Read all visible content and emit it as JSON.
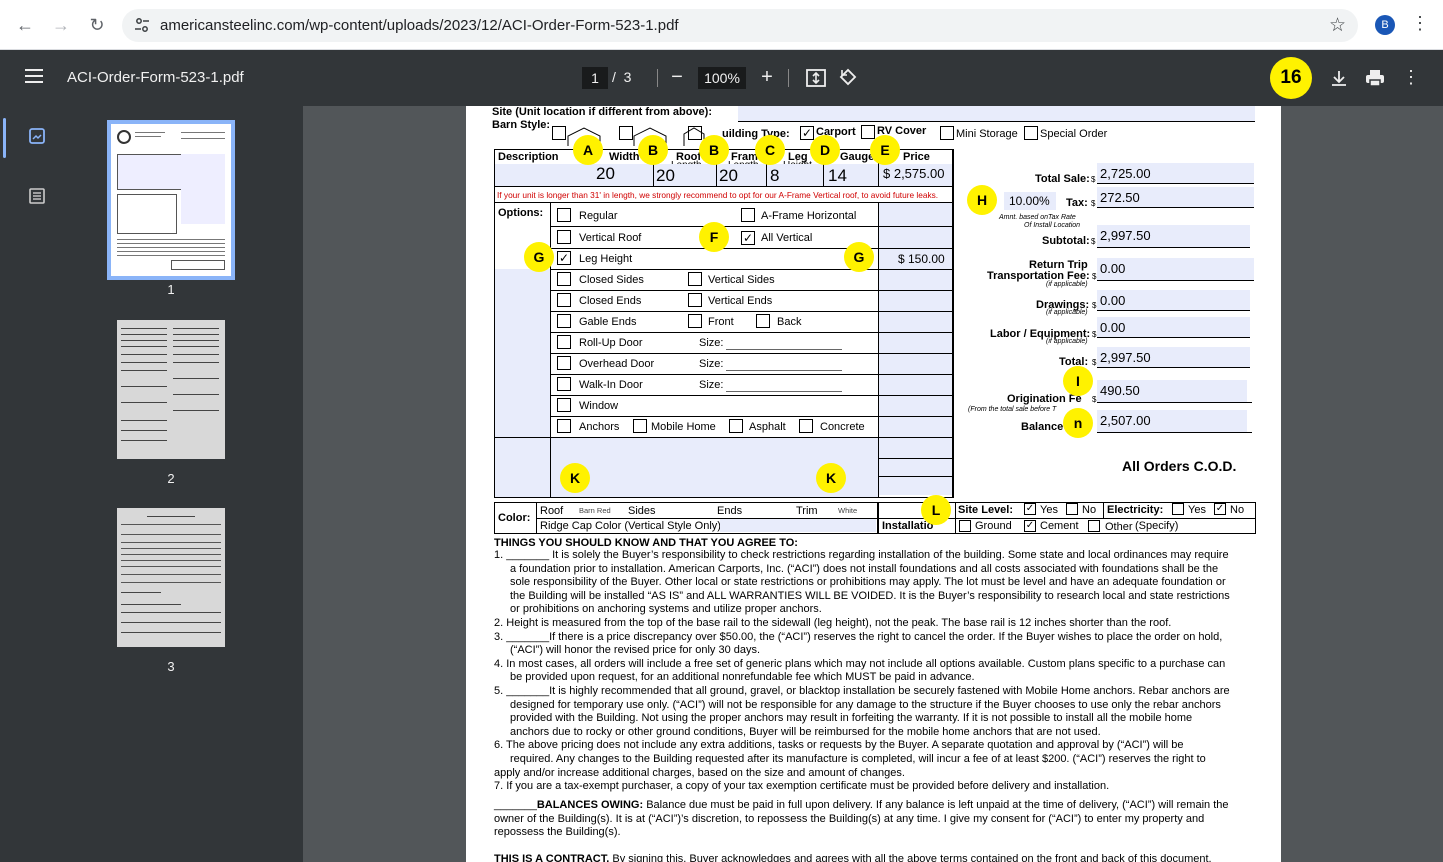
{
  "browser": {
    "url": "americansteelinc.com/wp-content/uploads/2023/12/ACI-Order-Form-523-1.pdf",
    "profile_initial": "B"
  },
  "viewer": {
    "filename": "ACI-Order-Form-523-1.pdf",
    "current_page": "1",
    "page_sep": "/",
    "total_pages": "3",
    "zoom": "100%",
    "badge": "16",
    "thumbnails": [
      "1",
      "2",
      "3"
    ]
  },
  "form": {
    "site_label": "Site (Unit location if different from above):",
    "barn_style": "Barn Style:",
    "building_type": "uilding Type:",
    "carport": "Carport",
    "rv_cover": "RV Cover",
    "mini_storage": "Mini Storage",
    "special_order": "Special Order",
    "headers": {
      "description": "Description",
      "width": "Width",
      "roof": "Roof",
      "roof_sub": "Length",
      "frame": "Frame",
      "frame_sub": "Length",
      "leg": "Leg",
      "leg_sub": "Height",
      "gauge": "Gauge",
      "price": "Price"
    },
    "values": {
      "width": "20",
      "roof": "20",
      "frame": "20",
      "leg": "8",
      "gauge": "14",
      "price": "$ 2,575.00"
    },
    "warning": "If your unit is longer than 31' in length, we strongly recommend to opt for our A-Frame Vertical roof, to avoid future leaks.",
    "options_label": "Options:",
    "options": {
      "regular": "Regular",
      "a_frame_horizontal": "A-Frame Horizontal",
      "vertical_roof": "Vertical Roof",
      "all_vertical": "All Vertical",
      "leg_height": "Leg Height",
      "leg_height_price": "$ 150.00",
      "closed_sides": "Closed Sides",
      "vertical_sides": "Vertical Sides",
      "closed_ends": "Closed Ends",
      "vertical_ends": "Vertical Ends",
      "gable_ends": "Gable Ends",
      "front": "Front",
      "back": "Back",
      "rollup_door": "Roll-Up Door",
      "overhead_door": "Overhead Door",
      "walkin_door": "Walk-In Door",
      "size": "Size:",
      "window": "Window",
      "anchors": "Anchors",
      "mobile_home": "Mobile Home",
      "asphalt": "Asphalt",
      "concrete": "Concrete"
    },
    "color": {
      "label": "Color:",
      "roof": "Roof",
      "roof_value": "Barn Red",
      "sides": "Sides",
      "ends": "Ends",
      "trim": "Trim",
      "trim_value": "White",
      "ridge_cap": "Ridge Cap Color (Vertical Style Only):",
      "installation": "Installatio"
    },
    "site_level": {
      "label": "Site Level:",
      "yes": "Yes",
      "no": "No",
      "electricity": "Electricity:",
      "ground": "Ground",
      "cement": "Cement",
      "other": "Other",
      "specify": "(Specify)"
    },
    "totals": {
      "total_sale_label": "Total Sale:",
      "total_sale": "2,725.00",
      "tax_rate": "10.00%",
      "tax_label": "Tax:",
      "tax": "272.50",
      "tax_note1": "Amnt. based onTax Rate",
      "tax_note2": "Of Install Location",
      "subtotal_label": "Subtotal:",
      "subtotal": "2,997.50",
      "return_trip_label": "Return Trip",
      "transport_label": "Transportation Fee:",
      "transport_note": "(if applicable)",
      "transport": "0.00",
      "drawings_label": "Drawings:",
      "drawings_note": "(if applicable)",
      "drawings": "0.00",
      "labor_label": "Labor / Equipment:",
      "labor_note": "(if applicable)",
      "labor": "0.00",
      "total_label": "Total:",
      "total": "2,997.50",
      "origination_label": "Origination Fe",
      "origination_note": "(From the total sale before T",
      "origination": "490.50",
      "balance_label": "Balance D",
      "balance": "2,507.00",
      "dollar": "$",
      "cod": "All Orders C.O.D."
    },
    "markers": {
      "a": "A",
      "b": "B",
      "c": "C",
      "d": "D",
      "e": "E",
      "f": "F",
      "g": "G",
      "h": "H",
      "i": "I",
      "n": "n",
      "k": "K",
      "l": "L"
    },
    "terms": {
      "heading": "THINGS YOU SHOULD KNOW AND THAT YOU AGREE TO:",
      "t1n": "1.",
      "t1a": "_______ It is solely the Buyer’s responsibility to check restrictions regarding installation of the building. Some state and local ordinances may require",
      "t1b": "a foundation prior to installation. American Carports, Inc. (“ACI”) does not install foundations and all costs associated with foundations shall be the",
      "t1c": "sole responsibility of the Buyer. Other local or state restrictions or prohibitions may apply. The lot must be level and have an adequate foundation or",
      "t1d": "the Building will be installed “AS IS” and ALL WARRANTIES WILL BE VOIDED. It is the Buyer’s responsibility to research local and state restrictions",
      "t1e": "or prohibitions on anchoring systems and utilize proper anchors.",
      "t2n": "2.",
      "t2a": "Height is measured from the top of the base rail to the sidewall (leg height), not the peak. The base rail is 12 inches shorter than the roof.",
      "t3n": "3.",
      "t3a": "_______If there is a price discrepancy over $50.00, the (“ACI”) reserves the right to cancel the order. If the Buyer wishes to place the order on hold,",
      "t3b": "(“ACI”) will honor the revised price for only 30 days.",
      "t4n": "4.",
      "t4a": "In most cases, all orders will include a free set of generic plans which may not include all options available. Custom plans specific to a purchase can",
      "t4b": "be provided upon request, for an additional nonrefundable fee which MUST be paid in advance.",
      "t5n": "5.",
      "t5a": "_______It is highly recommended that all ground, gravel, or blacktop installation be securely fastened with Mobile Home anchors. Rebar anchors are",
      "t5b": "designed for temporary use only. (“ACI”) will not be responsible for any damage to the structure if the Buyer chooses to use only the rebar anchors",
      "t5c": "provided with the Building. Not using the proper anchors may result in forfeiting the warranty. If it is not possible to install all the mobile home",
      "t5d": "anchors due to rocky or other ground conditions, Buyer will be reimbursed for the mobile home anchors that are not used.",
      "t6n": "6.",
      "t6a": "The above pricing does not include any extra additions, tasks or requests by the Buyer. A separate quotation and approval by (“ACI”) will be",
      "t6b": "required. Any changes to the Building requested after its manufacture is completed, will incur a fee of at least $200. (“ACI”) reserves the right to",
      "t6c": "apply and/or increase additional charges, based on the size and amount of changes.",
      "t7n": "7.",
      "t7a": "If you are a tax-exempt purchaser, a copy of your tax exemption certificate must be provided before delivery and installation.",
      "bal_blank": "_______",
      "bal_bold": "BALANCES OWING:",
      "bal_a": " Balance due must be paid in full upon delivery. If any balance is left unpaid at the time of delivery, (“ACI”) will remain the",
      "bal_b": "owner of the Building(s). It is at (“ACI”)’s discretion, to repossess the Building(s) at any time. I give my consent for (“ACI”) to enter my property and",
      "bal_c": "repossess the Building(s).",
      "contract_bold": "THIS IS A CONTRACT.",
      "contract_rest": " By signing this, Buyer acknowledges and agrees with all the above terms contained on the front and back of this document."
    }
  },
  "colors": {
    "toolbar": "#323639",
    "viewer_bg": "#525659",
    "highlight": "#fff200",
    "field_fill": "#e8ecfb",
    "warning_red": "#d00000"
  }
}
